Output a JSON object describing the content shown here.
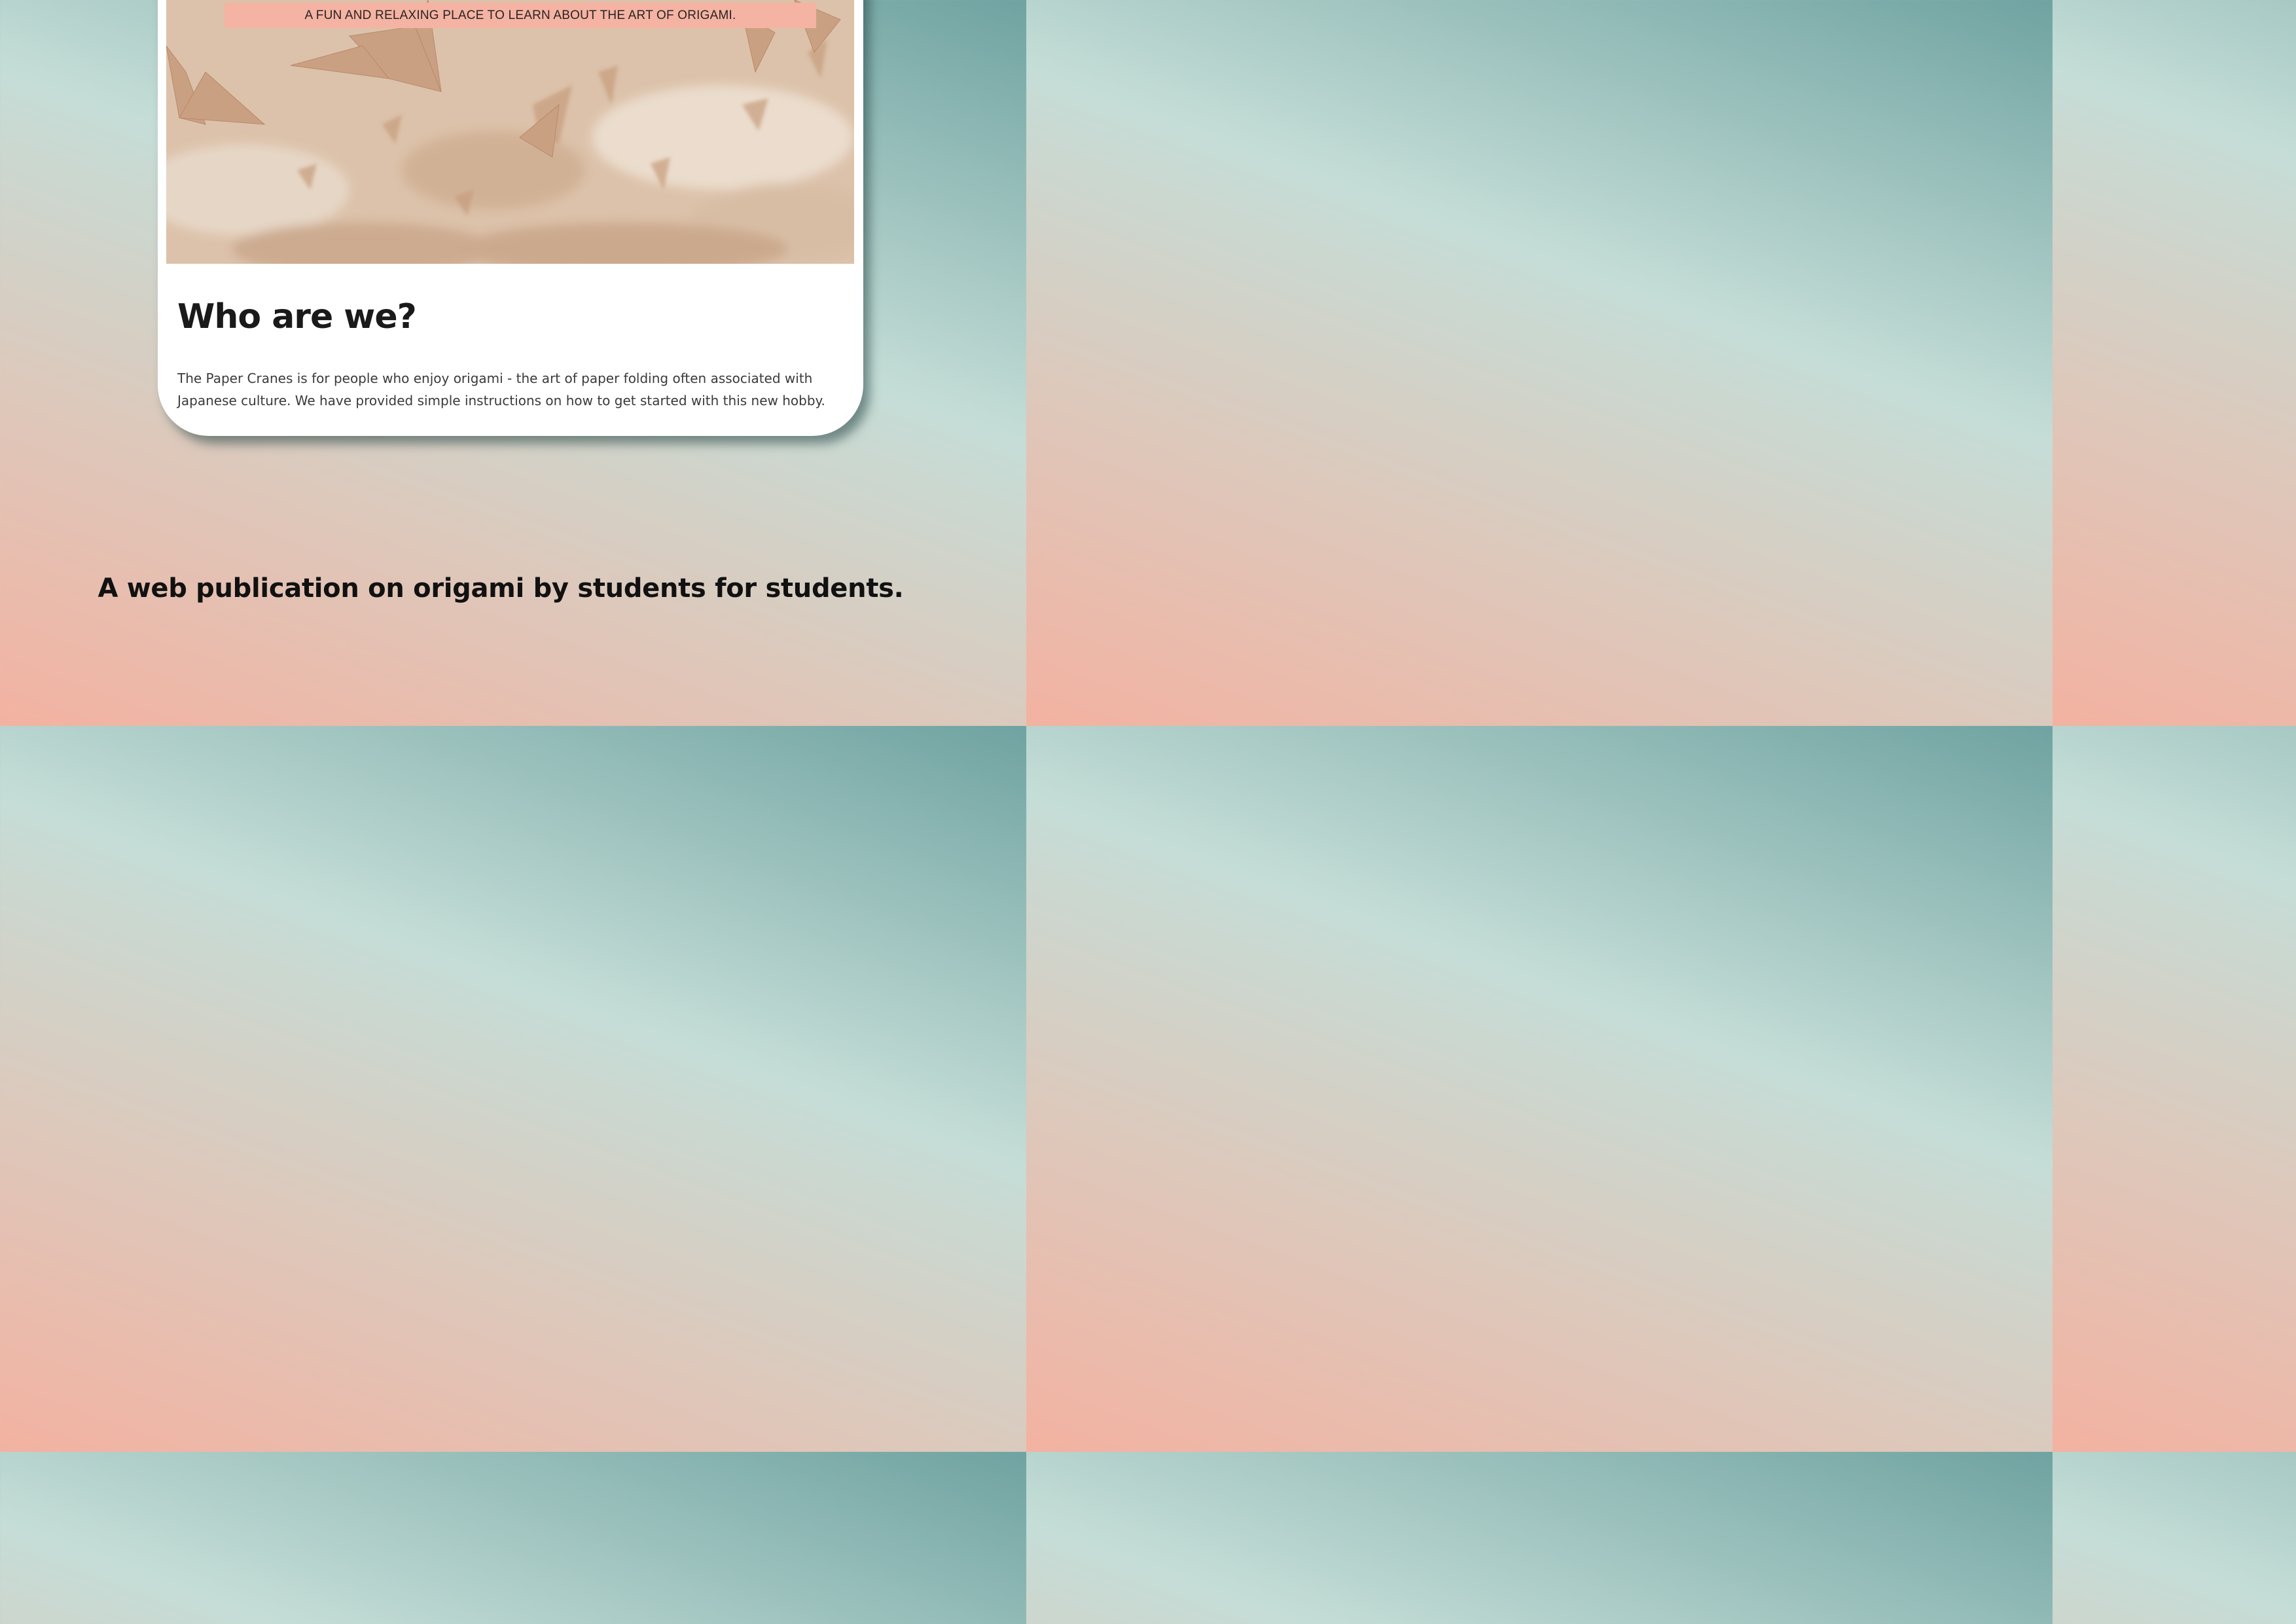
{
  "site": {
    "tagline": "A FUN AND RELAXING PLACE TO LEARN ABOUT THE ART OF ORIGAMI.",
    "hero_image": "paper-cranes-photo"
  },
  "about": {
    "heading": "Who are we?",
    "body": "The Paper Cranes is for people who enjoy origami - the art of paper folding often associated with Japanese culture. We have provided simple instructions on how to get started with this new hobby."
  },
  "caption": "A web publication on origami by students for students.",
  "colors": {
    "accent": "#f4b3a3",
    "background_teal": "#6fa3a1",
    "background_peach": "#f3b2a1"
  }
}
